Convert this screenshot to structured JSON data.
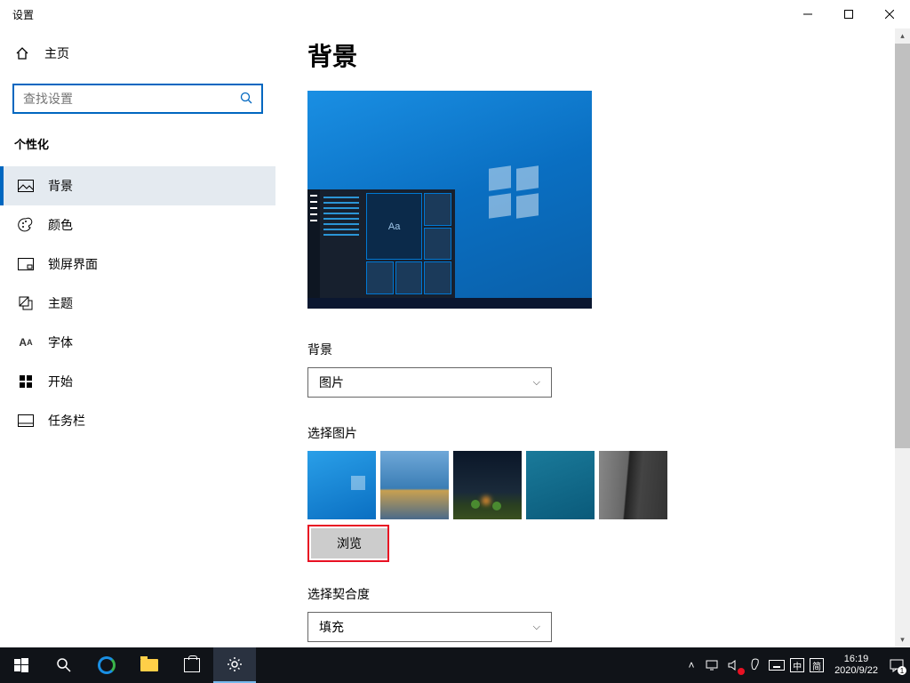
{
  "window": {
    "title": "设置"
  },
  "sidebar": {
    "home": "主页",
    "search_placeholder": "查找设置",
    "category": "个性化",
    "items": [
      {
        "label": "背景",
        "active": true
      },
      {
        "label": "颜色"
      },
      {
        "label": "锁屏界面"
      },
      {
        "label": "主题"
      },
      {
        "label": "字体"
      },
      {
        "label": "开始"
      },
      {
        "label": "任务栏"
      }
    ]
  },
  "page": {
    "title": "背景",
    "preview_sample_text": "Aa",
    "bg_label": "背景",
    "bg_value": "图片",
    "choose_label": "选择图片",
    "browse": "浏览",
    "fit_label": "选择契合度",
    "fit_value": "填充"
  },
  "taskbar": {
    "ime1": "中",
    "ime2": "简",
    "time": "16:19",
    "date": "2020/9/22",
    "notification_count": "1"
  }
}
